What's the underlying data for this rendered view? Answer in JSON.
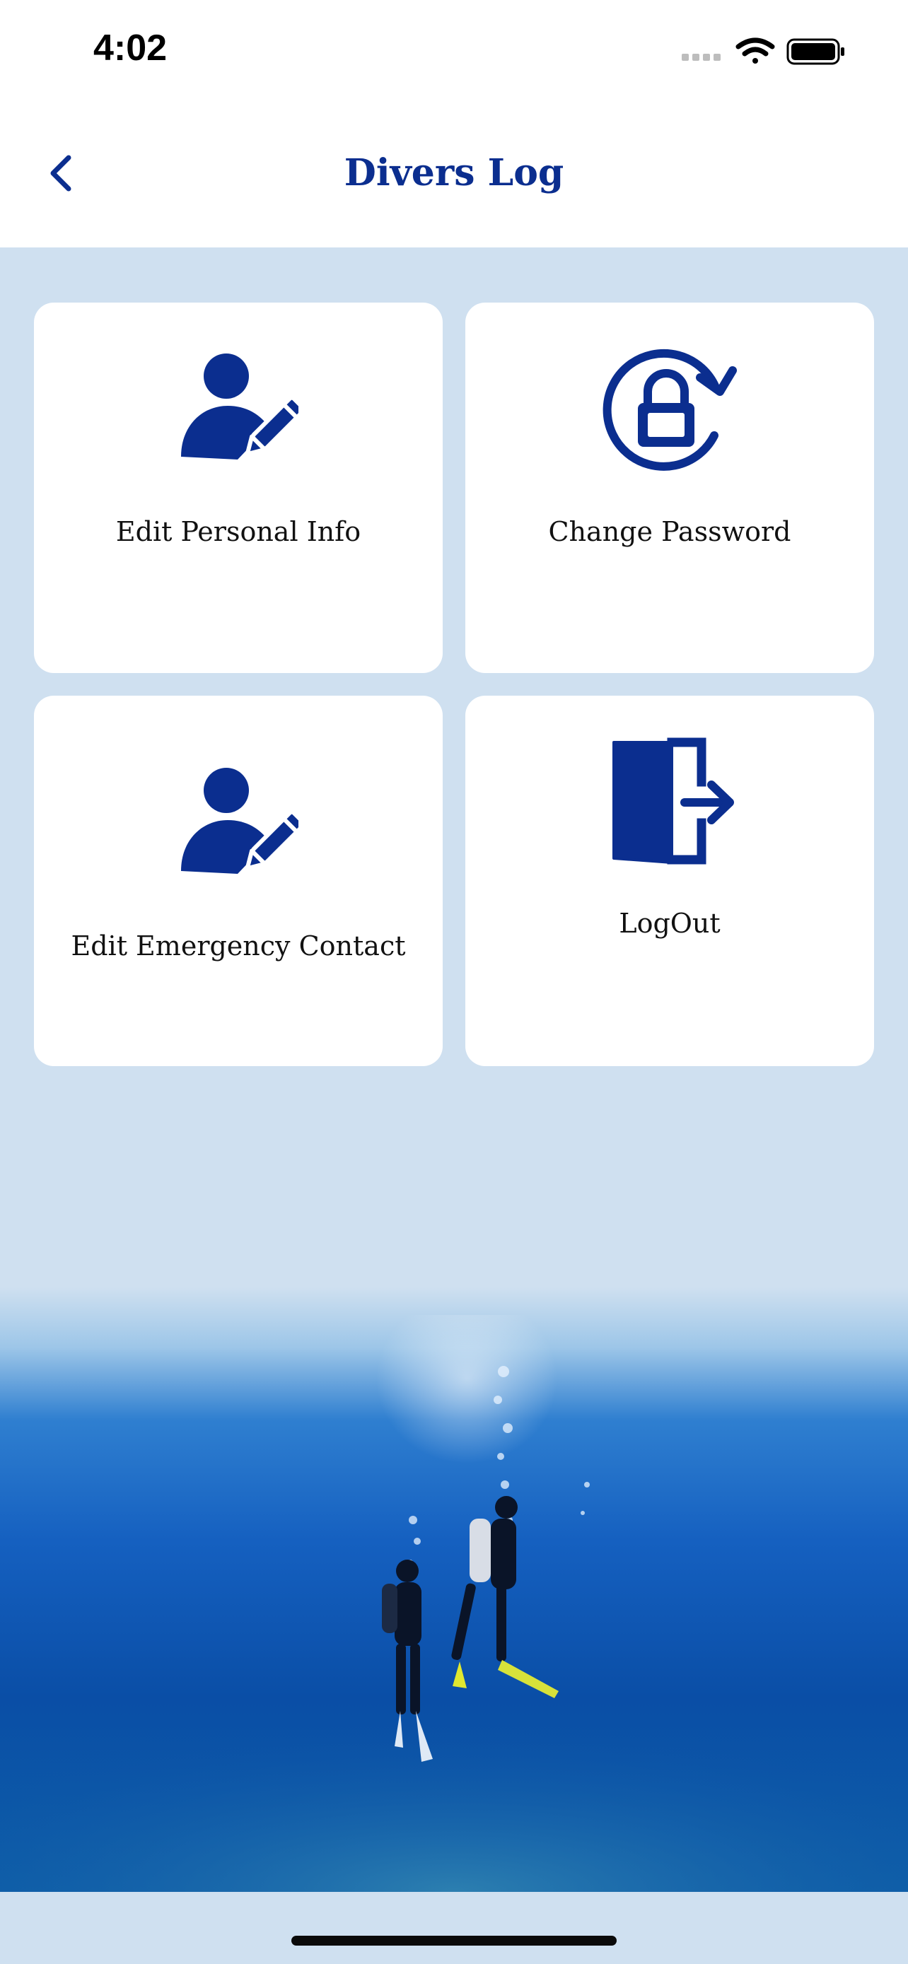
{
  "status_bar": {
    "time": "4:02"
  },
  "nav": {
    "title": "Divers Log"
  },
  "cards": [
    {
      "label": "Edit Personal Info",
      "icon": "user-edit-icon"
    },
    {
      "label": "Change Password",
      "icon": "lock-refresh-icon"
    },
    {
      "label": "Edit Emergency Contact",
      "icon": "user-edit-icon"
    },
    {
      "label": "LogOut",
      "icon": "logout-door-icon"
    }
  ],
  "colors": {
    "accent": "#0b2e8f",
    "background": "#cfe0f0",
    "card": "#ffffff"
  }
}
